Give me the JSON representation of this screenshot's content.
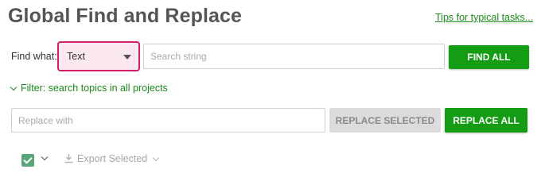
{
  "header": {
    "title": "Global Find and Replace",
    "tips_link": "Tips for typical tasks..."
  },
  "find": {
    "label": "Find what:",
    "type_select": {
      "value": "Text"
    },
    "search_placeholder": "Search string",
    "search_value": "",
    "find_all_label": "FIND ALL"
  },
  "filter": {
    "label": "Filter: search topics in all projects",
    "icon": "chevron-down-icon"
  },
  "replace": {
    "placeholder": "Replace with",
    "value": "",
    "replace_selected_label": "REPLACE SELECTED",
    "replace_all_label": "REPLACE ALL"
  },
  "results_toolbar": {
    "select_all_checked": true,
    "export_label": "Export Selected",
    "export_icon": "download-icon"
  },
  "colors": {
    "accent_green": "#149c14",
    "link_green": "#1a8a1a",
    "select_highlight_border": "#d0206a",
    "select_highlight_bg": "#fce8f0",
    "checkbox_green": "#5aa57a",
    "disabled_bg": "#dcdcdc"
  }
}
